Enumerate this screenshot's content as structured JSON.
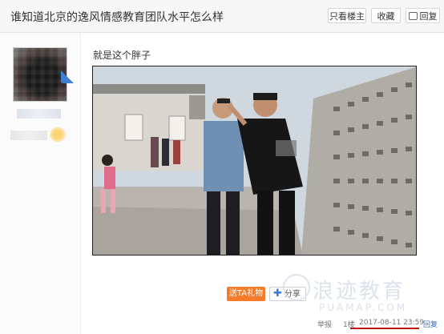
{
  "header": {
    "title": "谁知道北京的逸风情感教育团队水平怎么样",
    "buttons": [
      "只看楼主",
      "收藏",
      "回复"
    ]
  },
  "author": {
    "badge": "楼主"
  },
  "post": {
    "text": "就是这个胖子",
    "gift_label": "送TA礼物",
    "share_label": "分享",
    "report_label": "举报",
    "floor": "1楼",
    "timestamp": "2017-08-11 23:59",
    "reply_label": "回复"
  },
  "watermark": {
    "main": "浪迹教育",
    "sub": "PUAMAP.COM"
  },
  "colors": {
    "gift": "#f47b29",
    "share_plus": "#3a7bd5",
    "badge": "#3e7fcf",
    "underline": "#c41111"
  }
}
